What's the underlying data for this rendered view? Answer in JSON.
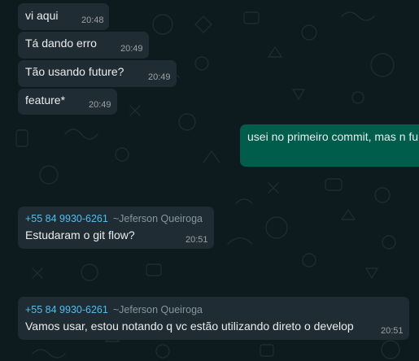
{
  "theme": {
    "background": "#0d1b1f",
    "incoming_bubble": "#202c33",
    "outgoing_bubble": "#005c4b",
    "sender_phone_color": "#53bdeb",
    "sender_name_color": "#8696a0",
    "text_color": "#e9edef"
  },
  "messages": [
    {
      "direction": "incoming",
      "text": "vi aqui",
      "time": "20:48"
    },
    {
      "direction": "incoming",
      "text": "Tá dando erro",
      "time": "20:49"
    },
    {
      "direction": "incoming",
      "text": "Tão usando future?",
      "time": "20:49"
    },
    {
      "direction": "incoming",
      "text": "feature*",
      "time": "20:49"
    },
    {
      "direction": "outgoing",
      "text": "usei no primeiro commit, mas n fu"
    },
    {
      "direction": "incoming",
      "sender_phone": "+55 84 9930-6261",
      "sender_name": "~Jeferson Queiroga",
      "text": "Estudaram o git flow?",
      "time": "20:51"
    },
    {
      "direction": "incoming",
      "sender_phone": "+55 84 9930-6261",
      "sender_name": "~Jeferson Queiroga",
      "text": "Vamos usar, estou notando q vc estão utilizando direto o develop",
      "time": "20:51"
    }
  ]
}
